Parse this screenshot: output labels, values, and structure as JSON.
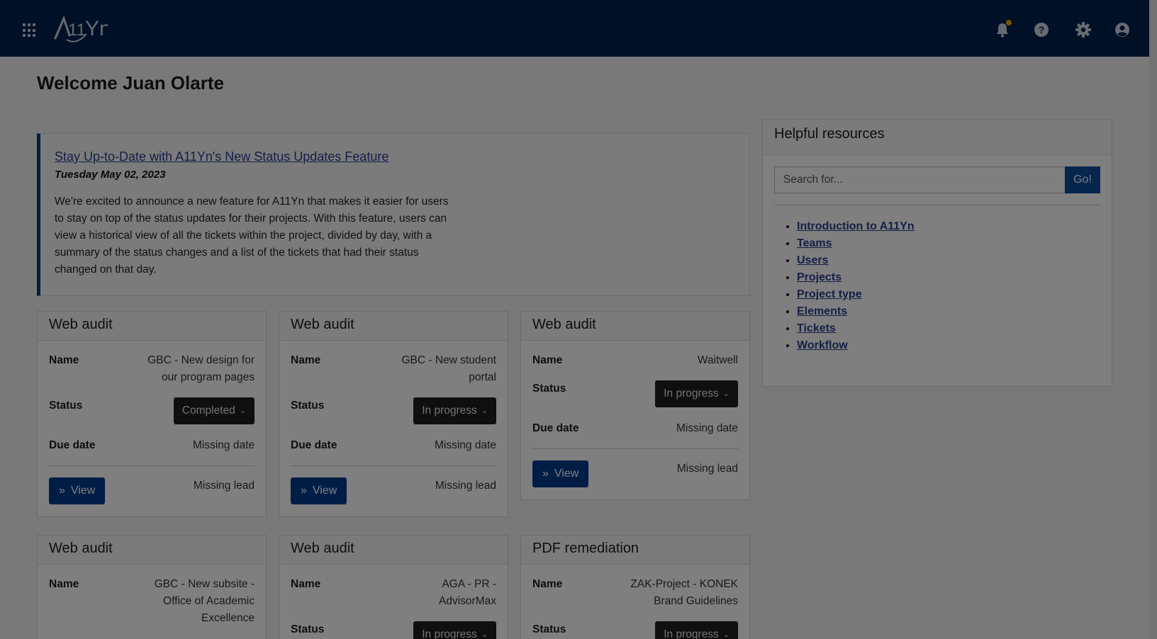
{
  "header": {
    "logo_text": "A11Yn",
    "icons": [
      "apps-grid-icon",
      "bell-icon",
      "help-icon",
      "gear-icon",
      "user-icon"
    ],
    "colors": {
      "bar": "#00214d",
      "notification": "#f0a800"
    }
  },
  "welcome": "Welcome Juan Olarte",
  "news": {
    "title": "Stay Up-to-Date with A11Yn's New Status Updates Feature",
    "date": "Tuesday May 02, 2023",
    "body": "We're excited to announce a new feature for A11Yn that makes it easier for users to stay on top of the status updates for their projects. With this feature, users can view a historical view of all the tickets within the project, divided by day, with a summary of the status changes and a list of the tickets that had their status changed on that day."
  },
  "labels": {
    "name": "Name",
    "status": "Status",
    "due_date": "Due date",
    "view": "View"
  },
  "cards": [
    {
      "type": "Web audit",
      "name": "GBC - New design for our program pages",
      "status": "Completed",
      "due": "Missing date",
      "lead": "Missing lead"
    },
    {
      "type": "Web audit",
      "name": "GBC - New student portal",
      "status": "In progress",
      "due": "Missing date",
      "lead": "Missing lead"
    },
    {
      "type": "Web audit",
      "name": "Waitwell",
      "status": "In progress",
      "due": "Missing date",
      "lead": "Missing lead"
    },
    {
      "type": "Web audit",
      "name": "GBC - New subsite - Office of Academic Excellence",
      "status": ""
    },
    {
      "type": "Web audit",
      "name": "AGA - PR - AdvisorMax",
      "status": "In progress"
    },
    {
      "type": "PDF remediation",
      "name": "ZAK-Project - KONEK Brand Guidelines",
      "status": "In progress"
    }
  ],
  "resources": {
    "title": "Helpful resources",
    "search_placeholder": "Search for...",
    "go_label": "Go!",
    "links": [
      "Introduction to A11Yn",
      "Teams",
      "Users",
      "Projects",
      "Project type",
      "Elements",
      "Tickets",
      "Workflow"
    ]
  }
}
